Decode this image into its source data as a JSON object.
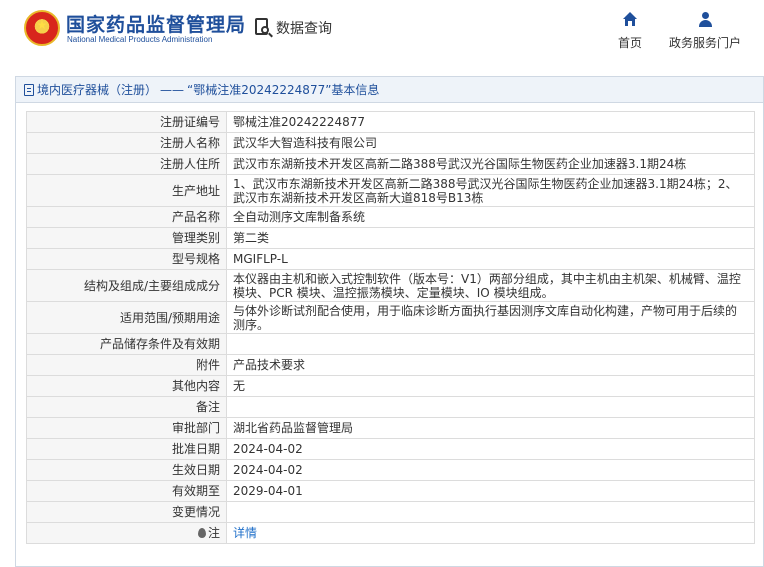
{
  "header": {
    "logo_cn": "国家药品监督管理局",
    "logo_en": "National Medical Products Administration",
    "query_label": "数据查询",
    "nav_home": "首页",
    "nav_gov": "政务服务门户"
  },
  "panel": {
    "breadcrumb_category": "境内医疗器械（注册）",
    "breadcrumb_sep": "——",
    "breadcrumb_page": "“鄂械注准20242224877”基本信息"
  },
  "fields": [
    {
      "label": "注册证编号",
      "value": "鄂械注准20242224877"
    },
    {
      "label": "注册人名称",
      "value": "武汉华大智造科技有限公司"
    },
    {
      "label": "注册人住所",
      "value": "武汉市东湖新技术开发区高新二路388号武汉光谷国际生物医药企业加速器3.1期24栋"
    },
    {
      "label": "生产地址",
      "value": "1、武汉市东湖新技术开发区高新二路388号武汉光谷国际生物医药企业加速器3.1期24栋；2、武汉市东湖新技术开发区高新大道818号B13栋"
    },
    {
      "label": "产品名称",
      "value": "全自动测序文库制备系统"
    },
    {
      "label": "管理类别",
      "value": "第二类"
    },
    {
      "label": "型号规格",
      "value": "MGIFLP-L"
    },
    {
      "label": "结构及组成/主要组成成分",
      "value": "本仪器由主机和嵌入式控制软件（版本号：V1）两部分组成，其中主机由主机架、机械臂、温控模块、PCR 模块、温控振荡模块、定量模块、IO 模块组成。"
    },
    {
      "label": "适用范围/预期用途",
      "value": "与体外诊断试剂配合使用，用于临床诊断方面执行基因测序文库自动化构建，产物可用于后续的测序。"
    },
    {
      "label": "产品储存条件及有效期",
      "value": ""
    },
    {
      "label": "附件",
      "value": "产品技术要求"
    },
    {
      "label": "其他内容",
      "value": "无"
    },
    {
      "label": "备注",
      "value": ""
    },
    {
      "label": "审批部门",
      "value": "湖北省药品监督管理局"
    },
    {
      "label": "批准日期",
      "value": "2024-04-02"
    },
    {
      "label": "生效日期",
      "value": "2024-04-02"
    },
    {
      "label": "有效期至",
      "value": "2029-04-01"
    },
    {
      "label": "变更情况",
      "value": ""
    }
  ],
  "note": {
    "label": "注",
    "link": "详情"
  },
  "colors": {
    "brand_blue": "#1f4f9b",
    "link_blue": "#1f6fc9",
    "label_bg": "#f6f6f6",
    "title_bg": "#eef3f9"
  }
}
